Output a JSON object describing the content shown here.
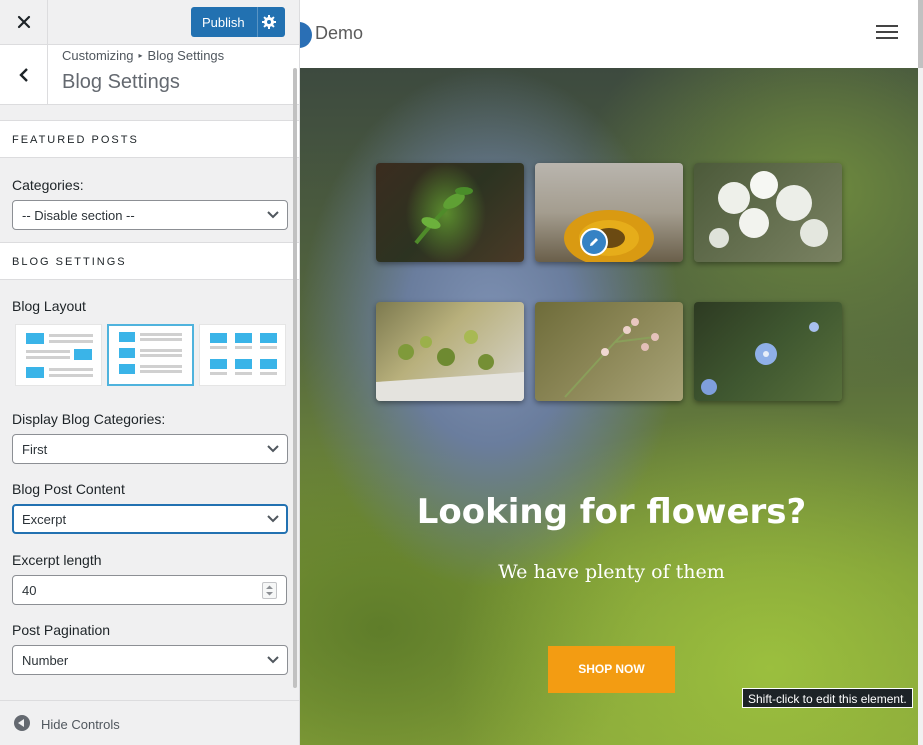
{
  "topbar": {
    "close_icon": "close-icon",
    "publish_label": "Publish",
    "settings_icon": "gear-icon",
    "publish_color": "#2271b1"
  },
  "section": {
    "back_icon": "chevron-left-icon",
    "breadcrumb_root": "Customizing",
    "breadcrumb_current": "Blog Settings",
    "title": "Blog Settings"
  },
  "featured_posts": {
    "heading": "FEATURED POSTS",
    "categories_label": "Categories:",
    "categories_value": "-- Disable section --"
  },
  "blog_settings": {
    "heading": "BLOG SETTINGS",
    "layout_label": "Blog Layout",
    "layout_options": [
      {
        "name": "alternating-list",
        "selected": false
      },
      {
        "name": "left-thumbnail-list",
        "selected": true
      },
      {
        "name": "grid",
        "selected": false
      }
    ],
    "display_categories_label": "Display Blog Categories:",
    "display_categories_value": "First",
    "post_content_label": "Blog Post Content",
    "post_content_value": "Excerpt",
    "excerpt_length_label": "Excerpt length",
    "excerpt_length_value": "40",
    "pagination_label": "Post Pagination",
    "pagination_value": "Number"
  },
  "footer": {
    "hide_controls_label": "Hide Controls"
  },
  "preview": {
    "site_name": "Demo",
    "menu_icon": "hamburger-icon",
    "hero_title": "Looking for flowers?",
    "hero_subtitle": "We have plenty of them",
    "cta_label": "SHOP NOW",
    "cta_color": "#f39c12",
    "edit_icon": "pencil-icon",
    "tooltip": "Shift-click to edit this element.",
    "gallery": [
      "plant-sprout",
      "sunflower",
      "white-blossoms",
      "moss-succulents",
      "pink-buds",
      "blue-wildflowers"
    ]
  }
}
